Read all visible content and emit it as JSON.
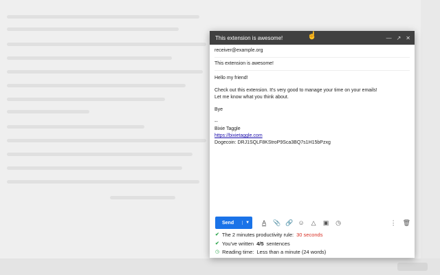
{
  "compose": {
    "title": "This extension is awesome!",
    "to": "receiver@example.org",
    "subject": "This extension is awesome!",
    "body": {
      "greeting": "Hello my friend!",
      "line1": "Check out this extension. It's very good to manage your time on your emails!",
      "line2": "Let me know what you think about.",
      "closing": "Bye",
      "sig_dash": "--",
      "sig_name": "Bixie Taggle",
      "sig_link": "https://bixietaggle.com",
      "sig_dogecoin": "Dogecoin: DRJ1SQLF8KStroP9Sca3BQ7s1H15bPzxg"
    }
  },
  "toolbar": {
    "send_label": "Send"
  },
  "stats": {
    "rule_label": "The 2 minutes productivity rule:",
    "rule_value": "30 seconds",
    "written_prefix": "You've written",
    "written_value": "4/5",
    "written_suffix": "sentences",
    "reading_label": "Reading time:",
    "reading_value": "Less than a minute (24 words)"
  },
  "colors": {
    "accent": "#1a73e8",
    "check": "#34a853",
    "warning": "#d93025"
  }
}
